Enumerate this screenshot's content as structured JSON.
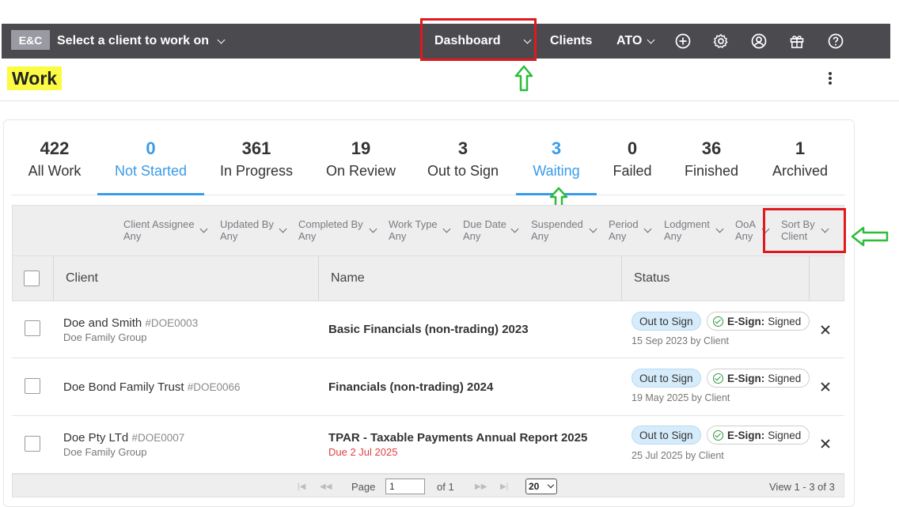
{
  "topnav": {
    "logo": "E&C",
    "client_select": "Select a client to work on",
    "dashboard": "Dashboard",
    "clients": "Clients",
    "ato": "ATO",
    "bg_color": "#4a4a4f"
  },
  "page": {
    "title": "Work"
  },
  "tabs": [
    {
      "count": "422",
      "label": "All Work"
    },
    {
      "count": "0",
      "label": "Not Started"
    },
    {
      "count": "361",
      "label": "In Progress"
    },
    {
      "count": "19",
      "label": "On Review"
    },
    {
      "count": "3",
      "label": "Out to Sign"
    },
    {
      "count": "3",
      "label": "Waiting"
    },
    {
      "count": "0",
      "label": "Failed"
    },
    {
      "count": "36",
      "label": "Finished"
    },
    {
      "count": "1",
      "label": "Archived"
    }
  ],
  "filters": [
    {
      "label": "Client Assignee",
      "value": "Any"
    },
    {
      "label": "Updated By",
      "value": "Any"
    },
    {
      "label": "Completed By",
      "value": "Any"
    },
    {
      "label": "Work Type",
      "value": "Any"
    },
    {
      "label": "Due Date",
      "value": "Any"
    },
    {
      "label": "Suspended",
      "value": "Any"
    },
    {
      "label": "Period",
      "value": "Any"
    },
    {
      "label": "Lodgment",
      "value": "Any"
    },
    {
      "label": "OoA",
      "value": "Any"
    },
    {
      "label": "Sort By",
      "value": "Client"
    }
  ],
  "table": {
    "headers": {
      "client": "Client",
      "name": "Name",
      "status": "Status"
    },
    "rows": [
      {
        "client": "Doe and Smith",
        "code": "#DOE0003",
        "group": "Doe Family Group",
        "name": "Basic Financials (non-trading) 2023",
        "due": "",
        "status": "Out to Sign",
        "esign_label": "E-Sign:",
        "esign_value": "Signed",
        "signed": "15 Sep 2023 by Client"
      },
      {
        "client": "Doe Bond Family Trust",
        "code": "#DOE0066",
        "group": "",
        "name": "Financials (non-trading) 2024",
        "due": "",
        "status": "Out to Sign",
        "esign_label": "E-Sign:",
        "esign_value": "Signed",
        "signed": "19 May 2025 by Client"
      },
      {
        "client": "Doe Pty LTd",
        "code": "#DOE0007",
        "group": "Doe Family Group",
        "name": "TPAR - Taxable Payments Annual Report 2025",
        "due": "Due 2 Jul 2025",
        "status": "Out to Sign",
        "esign_label": "E-Sign:",
        "esign_value": "Signed",
        "signed": "25 Jul 2025 by Client"
      }
    ]
  },
  "pager": {
    "page_label": "Page",
    "page_value": "1",
    "of_label": "of 1",
    "page_size": "20",
    "view_text": "View 1 - 3 of 3"
  },
  "colors": {
    "accent": "#3b9be6",
    "highlight_box": "#e0191f",
    "arrow": "#2bbd3a",
    "title_highlight": "#fbfb44"
  }
}
